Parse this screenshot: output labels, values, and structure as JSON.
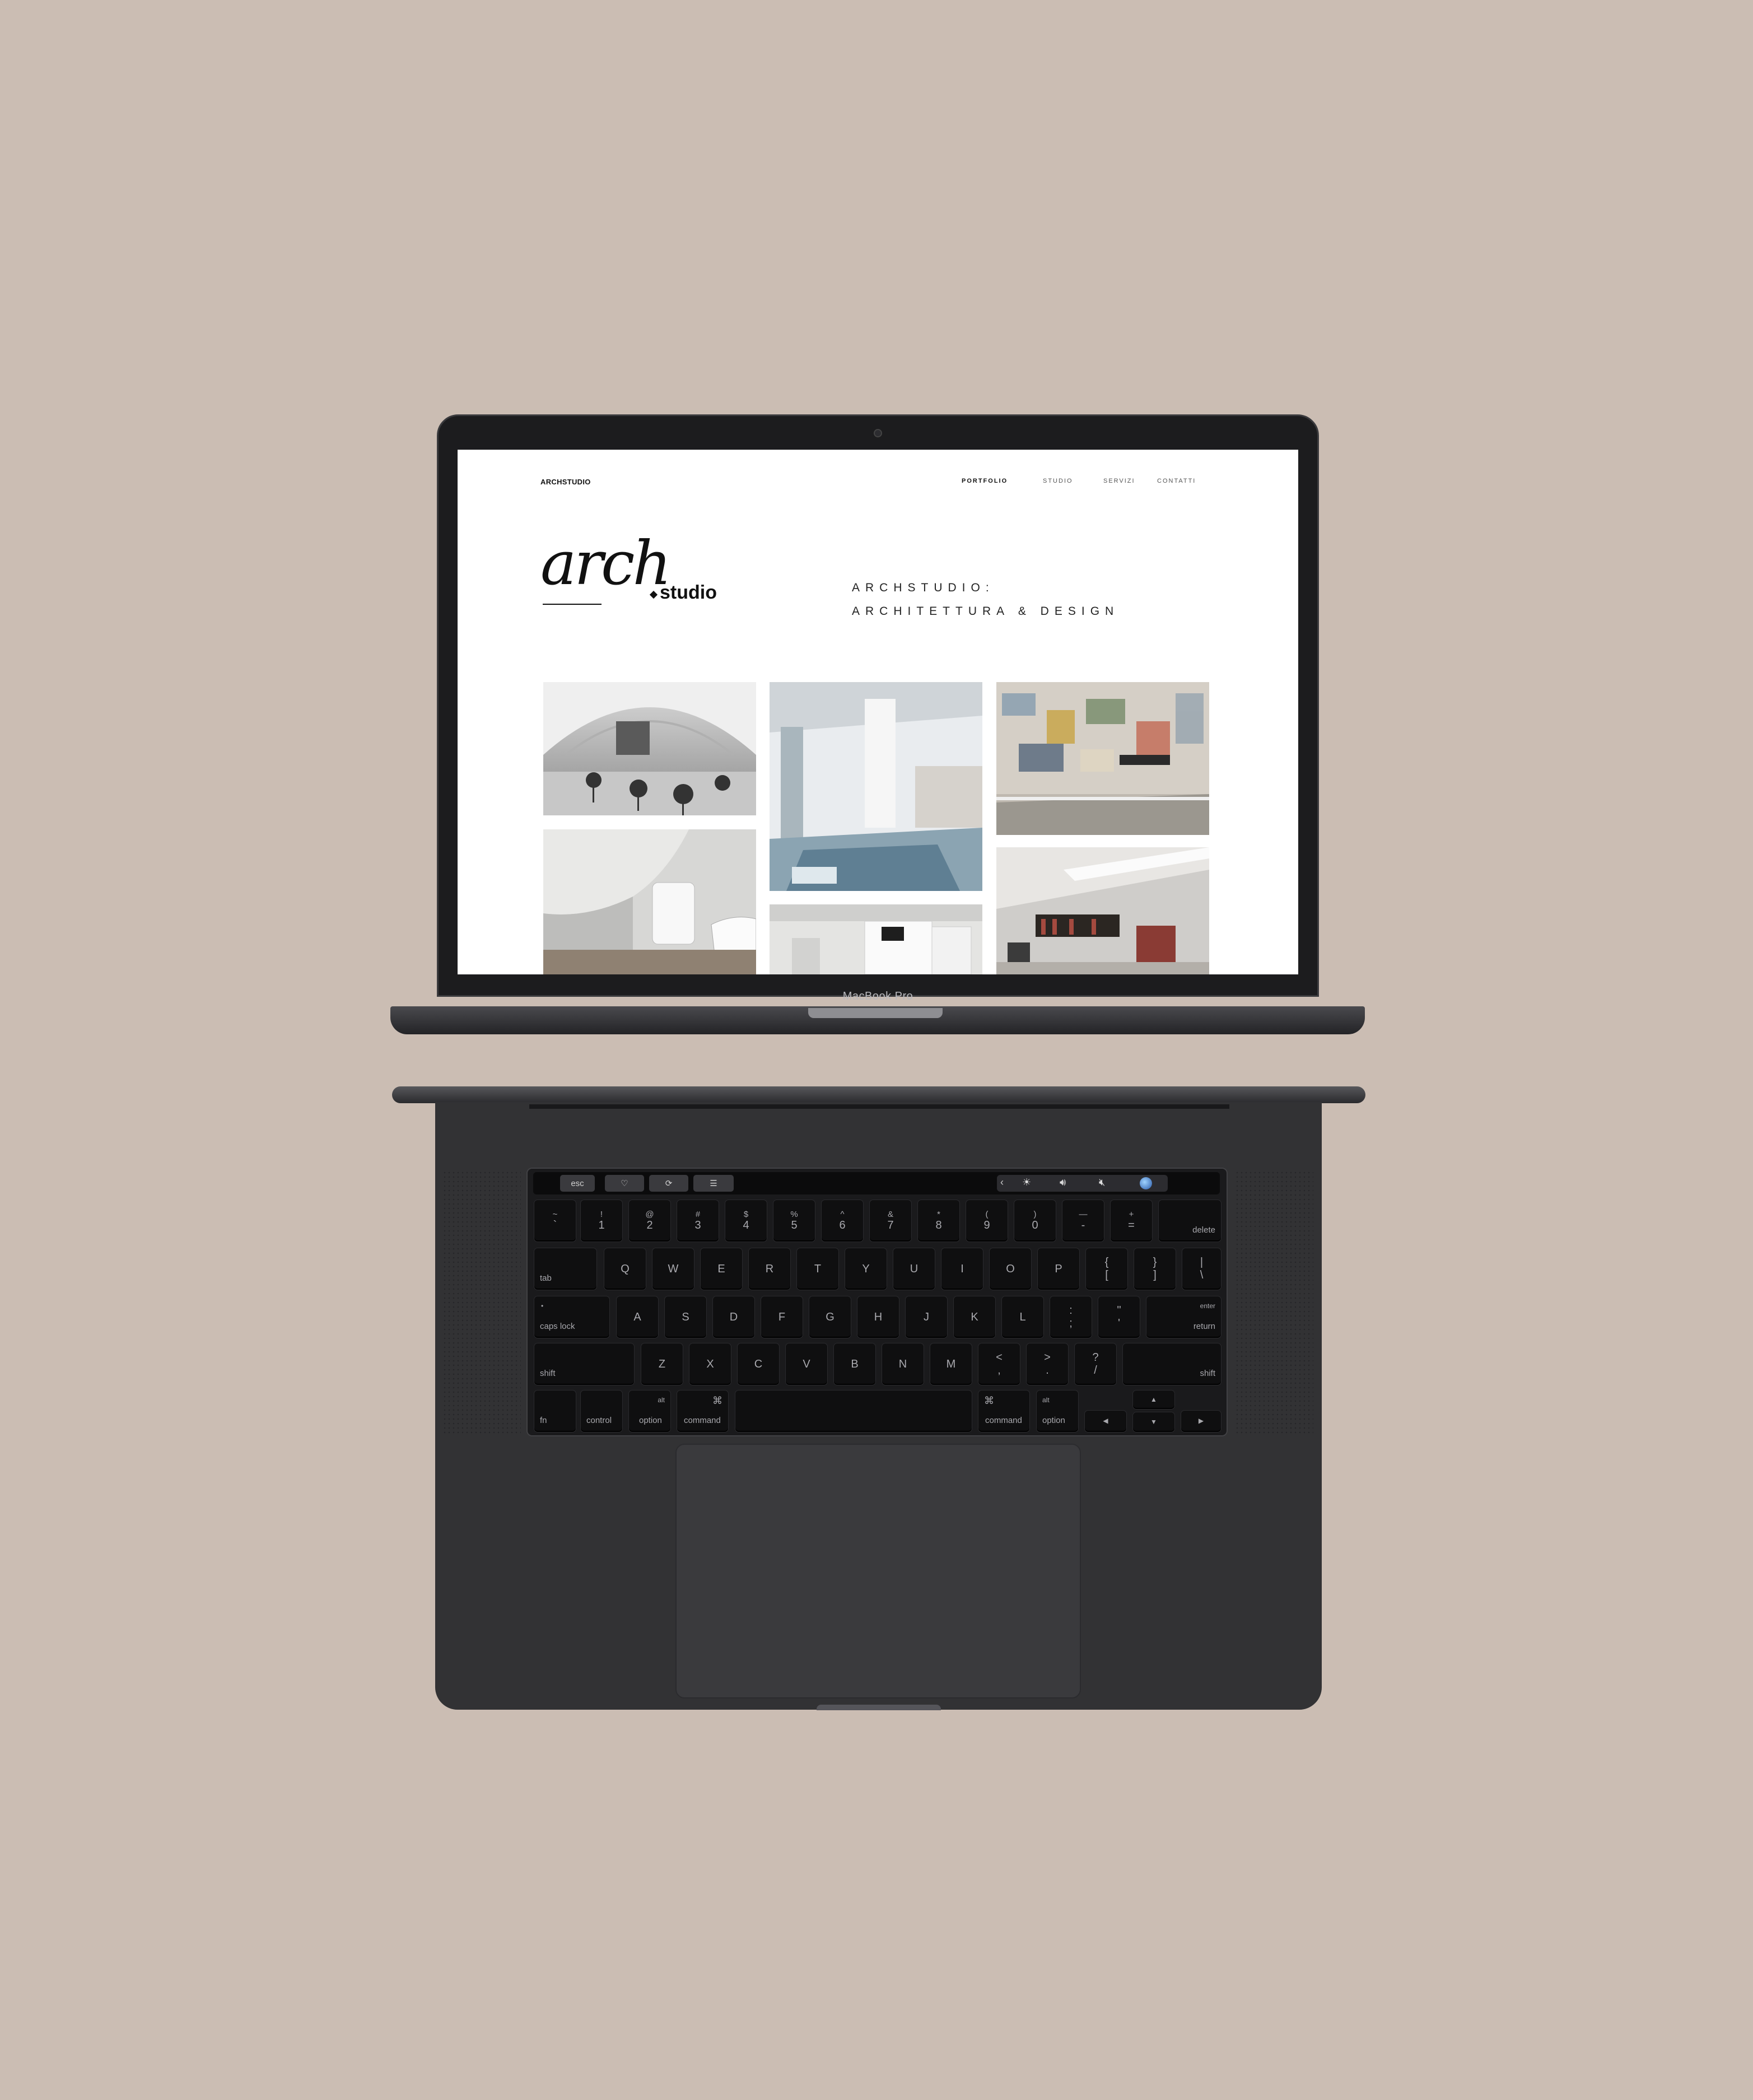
{
  "device": {
    "label": "MacBook Pro"
  },
  "website": {
    "brand": "ARCHSTUDIO",
    "nav": [
      {
        "label": "PORTFOLIO",
        "active": true
      },
      {
        "label": "STUDIO",
        "active": false
      },
      {
        "label": "SERVIZI",
        "active": false
      },
      {
        "label": "CONTATTI",
        "active": false
      }
    ],
    "logo": {
      "script": "arch",
      "suffix": "studio"
    },
    "tagline": {
      "line1": "ARCHSTUDIO:",
      "line2": "ARCHITETTURA & DESIGN"
    },
    "portfolio": [
      {
        "name": "vaulted-cafe-interior"
      },
      {
        "name": "bright-atrium-interior"
      },
      {
        "name": "poster-wall-interior"
      },
      {
        "name": "bathroom-interior"
      },
      {
        "name": "white-kitchen-interior"
      },
      {
        "name": "attic-bookshelf-interior"
      }
    ]
  },
  "touchbar": {
    "esc": "esc"
  },
  "keyboard": {
    "number_row": [
      {
        "top": "~",
        "bottom": "`"
      },
      {
        "top": "!",
        "bottom": "1"
      },
      {
        "top": "@",
        "bottom": "2"
      },
      {
        "top": "#",
        "bottom": "3"
      },
      {
        "top": "$",
        "bottom": "4"
      },
      {
        "top": "%",
        "bottom": "5"
      },
      {
        "top": "^",
        "bottom": "6"
      },
      {
        "top": "&",
        "bottom": "7"
      },
      {
        "top": "*",
        "bottom": "8"
      },
      {
        "top": "(",
        "bottom": "9"
      },
      {
        "top": ")",
        "bottom": "0"
      },
      {
        "top": "—",
        "bottom": "-"
      },
      {
        "top": "+",
        "bottom": "="
      }
    ],
    "delete": "delete",
    "tab": "tab",
    "qwerty_row": [
      "Q",
      "W",
      "E",
      "R",
      "T",
      "Y",
      "U",
      "I",
      "O",
      "P"
    ],
    "brackets": [
      {
        "top": "{",
        "bottom": "["
      },
      {
        "top": "}",
        "bottom": "]"
      },
      {
        "top": "|",
        "bottom": "\\"
      }
    ],
    "caps_lock": "caps lock",
    "home_row": [
      "A",
      "S",
      "D",
      "F",
      "G",
      "H",
      "J",
      "K",
      "L"
    ],
    "punct_home": [
      {
        "top": ":",
        "bottom": ";"
      },
      {
        "top": "\"",
        "bottom": "'"
      }
    ],
    "enter": "enter",
    "return": "return",
    "shift": "shift",
    "bottom_letters": [
      "Z",
      "X",
      "C",
      "V",
      "B",
      "N",
      "M"
    ],
    "punct_bottom": [
      {
        "top": "<",
        "bottom": ","
      },
      {
        "top": ">",
        "bottom": "."
      },
      {
        "top": "?",
        "bottom": "/"
      }
    ],
    "fn": "fn",
    "control": "control",
    "alt": "alt",
    "option": "option",
    "command": "command",
    "cmd_symbol": "⌘",
    "arrows": {
      "left": "◀",
      "up": "▲",
      "down": "▼",
      "right": "▶"
    }
  }
}
